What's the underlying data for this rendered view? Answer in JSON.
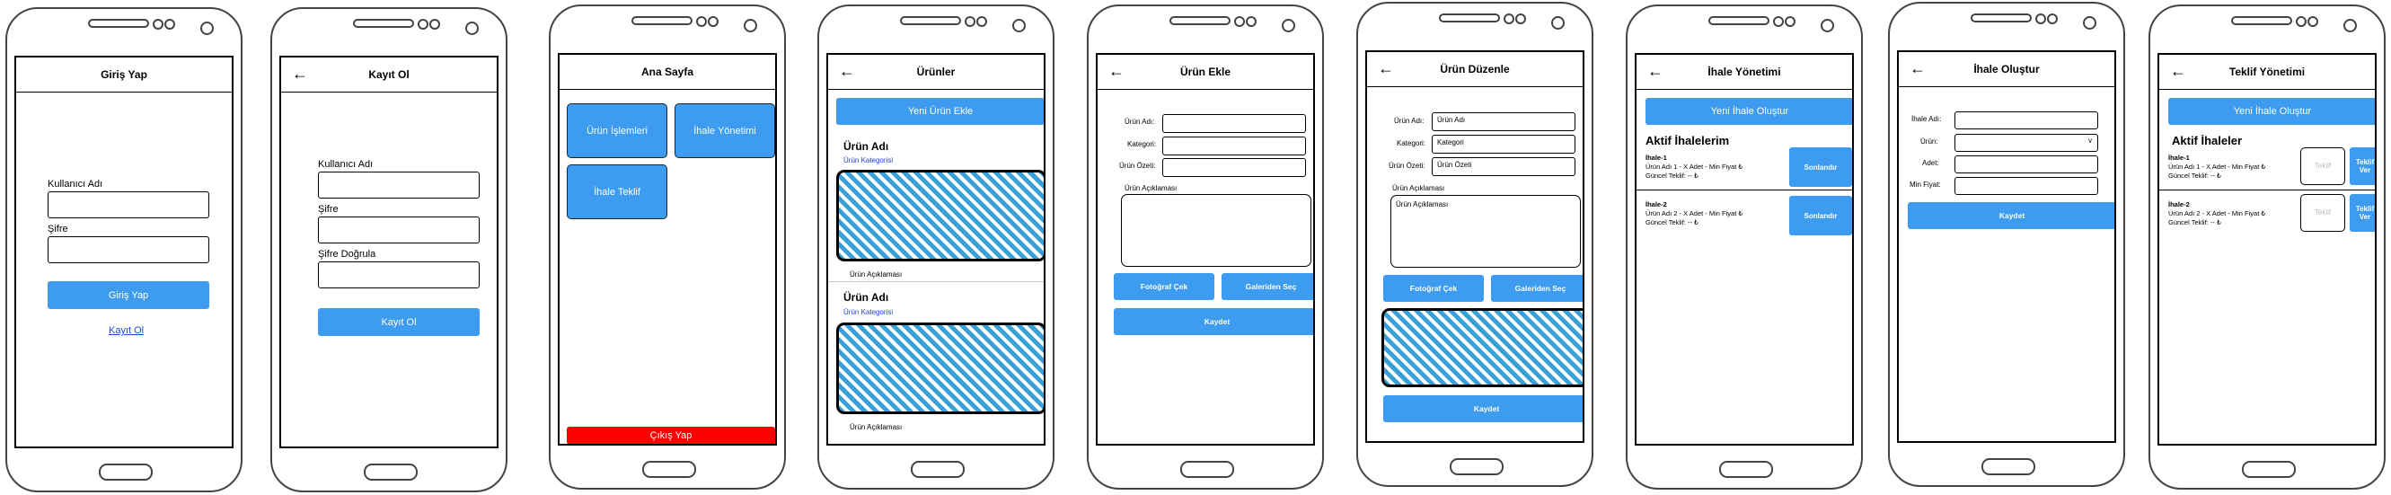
{
  "screens": {
    "giris": {
      "title": "Giriş Yap",
      "username_label": "Kullanıcı Adı",
      "password_label": "Şifre",
      "login_button": "Giriş Yap",
      "register_link": "Kayıt Ol"
    },
    "kayit": {
      "title": "Kayıt Ol",
      "back": "←",
      "username_label": "Kullanıcı Adı",
      "password_label": "Şifre",
      "password_confirm_label": "Şifre Doğrula",
      "register_button": "Kayıt Ol"
    },
    "ana": {
      "title": "Ana Sayfa",
      "urun_islemleri": "Ürün İşlemleri",
      "ihale_yonetimi": "İhale Yönetimi",
      "ihale_teklif": "İhale Teklif",
      "logout_button": "Çıkış Yap"
    },
    "urunler": {
      "title": "Ürünler",
      "back": "←",
      "new_button": "Yeni Ürün Ekle",
      "items": [
        {
          "name": "Ürün Adı",
          "category": "Ürün Kategorisi",
          "description": "Ürün Açıklaması"
        },
        {
          "name": "Ürün Adı",
          "category": "Ürün Kategorisi",
          "description": "Ürün Açıklaması"
        }
      ]
    },
    "urun_ekle": {
      "title": "Ürün Ekle",
      "back": "←",
      "name_label": "Ürün Adı:",
      "category_label": "Kategori:",
      "summary_label": "Ürün Özeti:",
      "description_label": "Ürün Açıklaması",
      "photo_button": "Fotoğraf Çek",
      "gallery_button": "Galeriden Seç",
      "save_button": "Kaydet"
    },
    "urun_duzenle": {
      "title": "Ürün Düzenle",
      "back": "←",
      "name_label": "Ürün Adı:",
      "name_value": "Ürün Adı",
      "category_label": "Kategori:",
      "category_value": "Kategori",
      "summary_label": "Ürün Özeti:",
      "summary_value": "Ürün Özeti",
      "description_label": "Ürün Açıklaması",
      "description_value": "Ürün Açıklaması",
      "photo_button": "Fotoğraf Çek",
      "gallery_button": "Galeriden Seç",
      "save_button": "Kaydet"
    },
    "ihale_yonetimi": {
      "title": "İhale Yönetimi",
      "back": "←",
      "new_button": "Yeni İhale Oluştur",
      "section_title": "Aktif İhalelerim",
      "items": [
        {
          "name": "İhale-1",
          "detail": "Ürün Adı 1 - X Adet - Min Fiyat ₺",
          "offer": "Güncel Teklif: -- ₺",
          "action": "Sonlandır"
        },
        {
          "name": "İhale-2",
          "detail": "Ürün Adı 2 - X Adet - Min Fiyat ₺",
          "offer": "Güncel Teklif: -- ₺",
          "action": "Sonlandır"
        }
      ]
    },
    "ihale_olustur": {
      "title": "İhale Oluştur",
      "back": "←",
      "name_label": "İhale Adı:",
      "product_label": "Ürün:",
      "product_arrow": "v",
      "quantity_label": "Adet:",
      "min_price_label": "Min Fiyat:",
      "save_button": "Kaydet"
    },
    "teklif": {
      "title": "Teklif Yönetimi",
      "back": "←",
      "new_button": "Yeni İhale Oluştur",
      "section_title": "Aktif İhaleler",
      "items": [
        {
          "name": "İhale-1",
          "detail": "Ürün Adı 1 - X Adet - Min Fiyat ₺",
          "offer": "Güncel Teklif: -- ₺",
          "input_placeholder": "Teklif",
          "action": "Teklif Ver"
        },
        {
          "name": "İhale-2",
          "detail": "Ürün Adı 2 - X Adet - Min Fiyat ₺",
          "offer": "Güncel Teklif: -- ₺",
          "input_placeholder": "Teklif",
          "action": "Teklif Ver"
        }
      ]
    }
  },
  "colors": {
    "button_blue": "#3d9bf0",
    "logout_red": "#ff0000",
    "hatch_blue": "#3aa0d8",
    "link_blue": "#1a4fd1"
  }
}
